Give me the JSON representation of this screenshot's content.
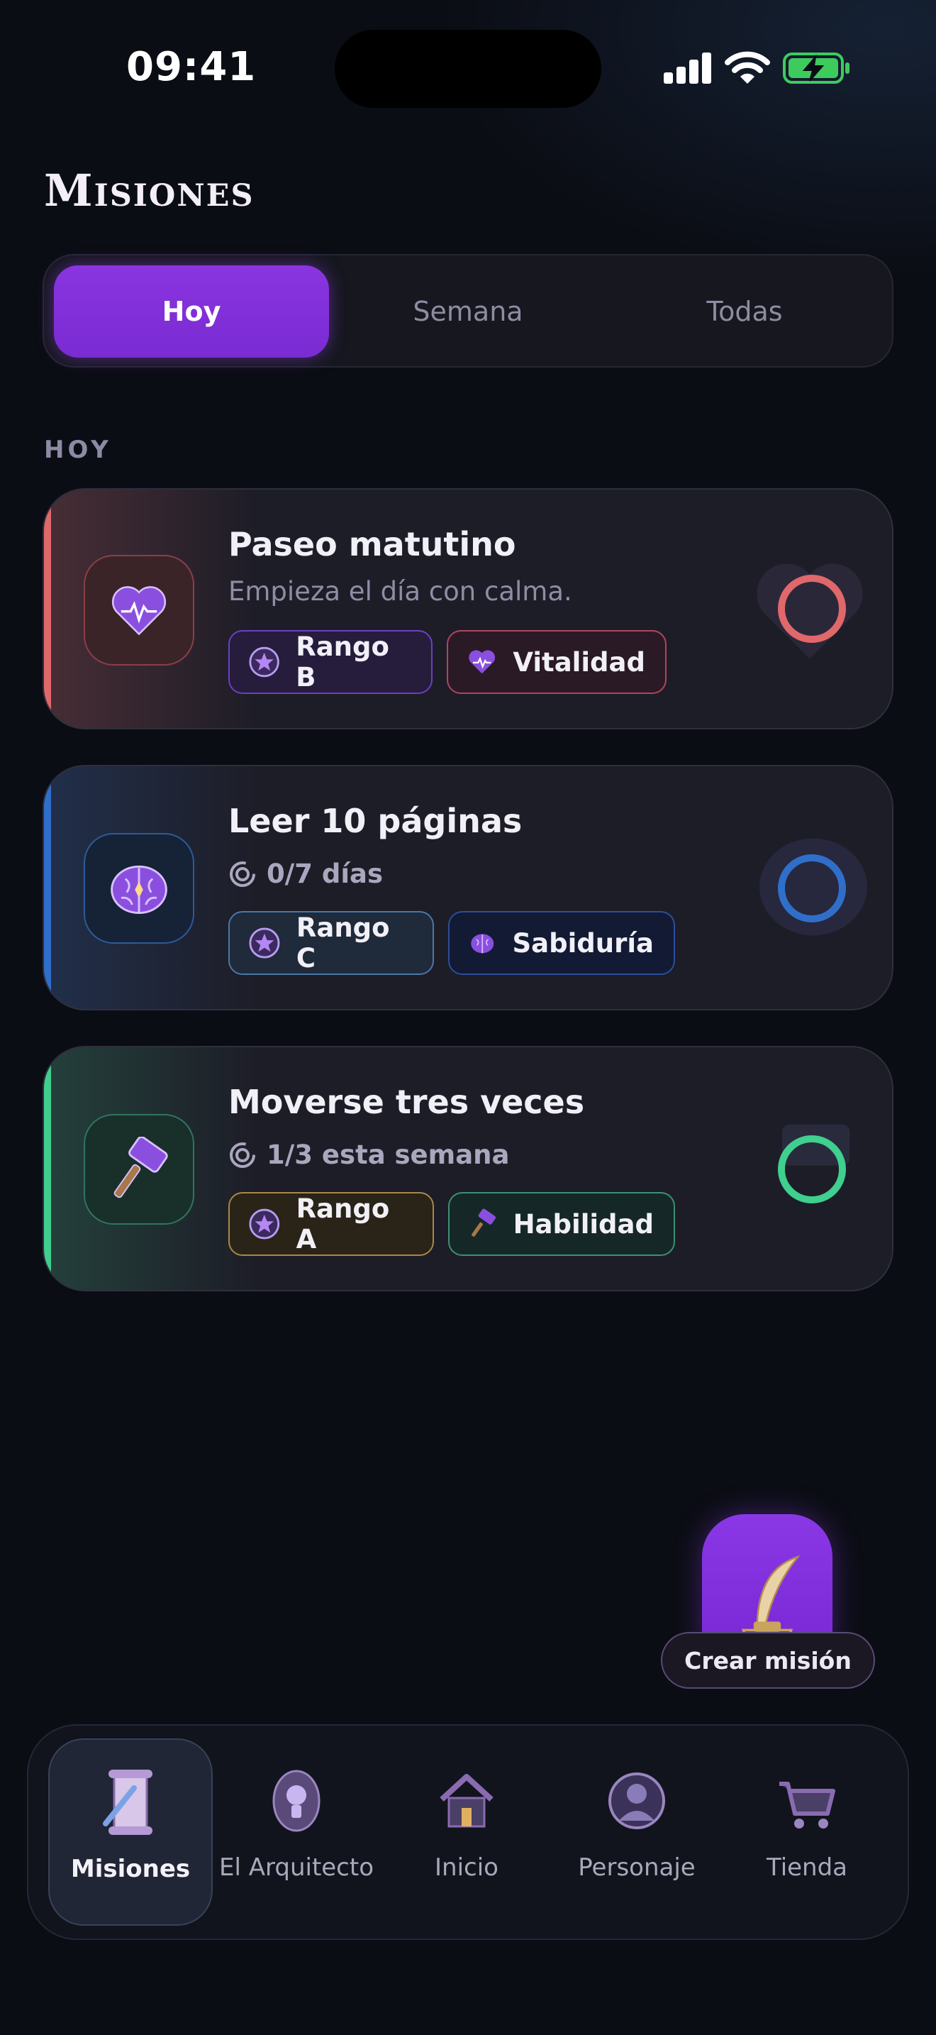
{
  "status_bar": {
    "time": "09:41"
  },
  "header": {
    "title": "Misiones"
  },
  "tabs": [
    {
      "label": "Hoy",
      "active": true
    },
    {
      "label": "Semana",
      "active": false
    },
    {
      "label": "Todas",
      "active": false
    }
  ],
  "section": {
    "label": "HOY"
  },
  "quests": [
    {
      "title": "Paseo matutino",
      "subtitle": "Empieza el día con calma.",
      "icon": "heart-icon",
      "accent": "#e0686a",
      "rank": "Rango B",
      "rank_border": "#6b3fc4",
      "attribute": "Vitalidad",
      "attribute_border": "#b0455e",
      "completed": false
    },
    {
      "title": "Leer 10 páginas",
      "progress": "0/7 días",
      "icon": "brain-icon",
      "accent": "#2f6fc9",
      "rank": "Rango C",
      "rank_border": "#4a78a8",
      "attribute": "Sabiduría",
      "attribute_border": "#2b4f9c",
      "completed": false
    },
    {
      "title": "Moverse tres veces",
      "progress": "1/3 esta semana",
      "icon": "hammer-icon",
      "accent": "#3fcf8e",
      "rank": "Rango A",
      "rank_border": "#a8884a",
      "attribute": "Habilidad",
      "attribute_border": "#3d8f78",
      "completed": false
    }
  ],
  "fab": {
    "label": "Crear misión",
    "icon": "quill-icon"
  },
  "bottom_nav": [
    {
      "label": "Misiones",
      "icon": "scroll-icon",
      "active": true
    },
    {
      "label": "El Arquitecto",
      "icon": "architect-icon",
      "active": false
    },
    {
      "label": "Inicio",
      "icon": "home-icon",
      "active": false
    },
    {
      "label": "Personaje",
      "icon": "character-icon",
      "active": false
    },
    {
      "label": "Tienda",
      "icon": "cart-icon",
      "active": false
    }
  ]
}
